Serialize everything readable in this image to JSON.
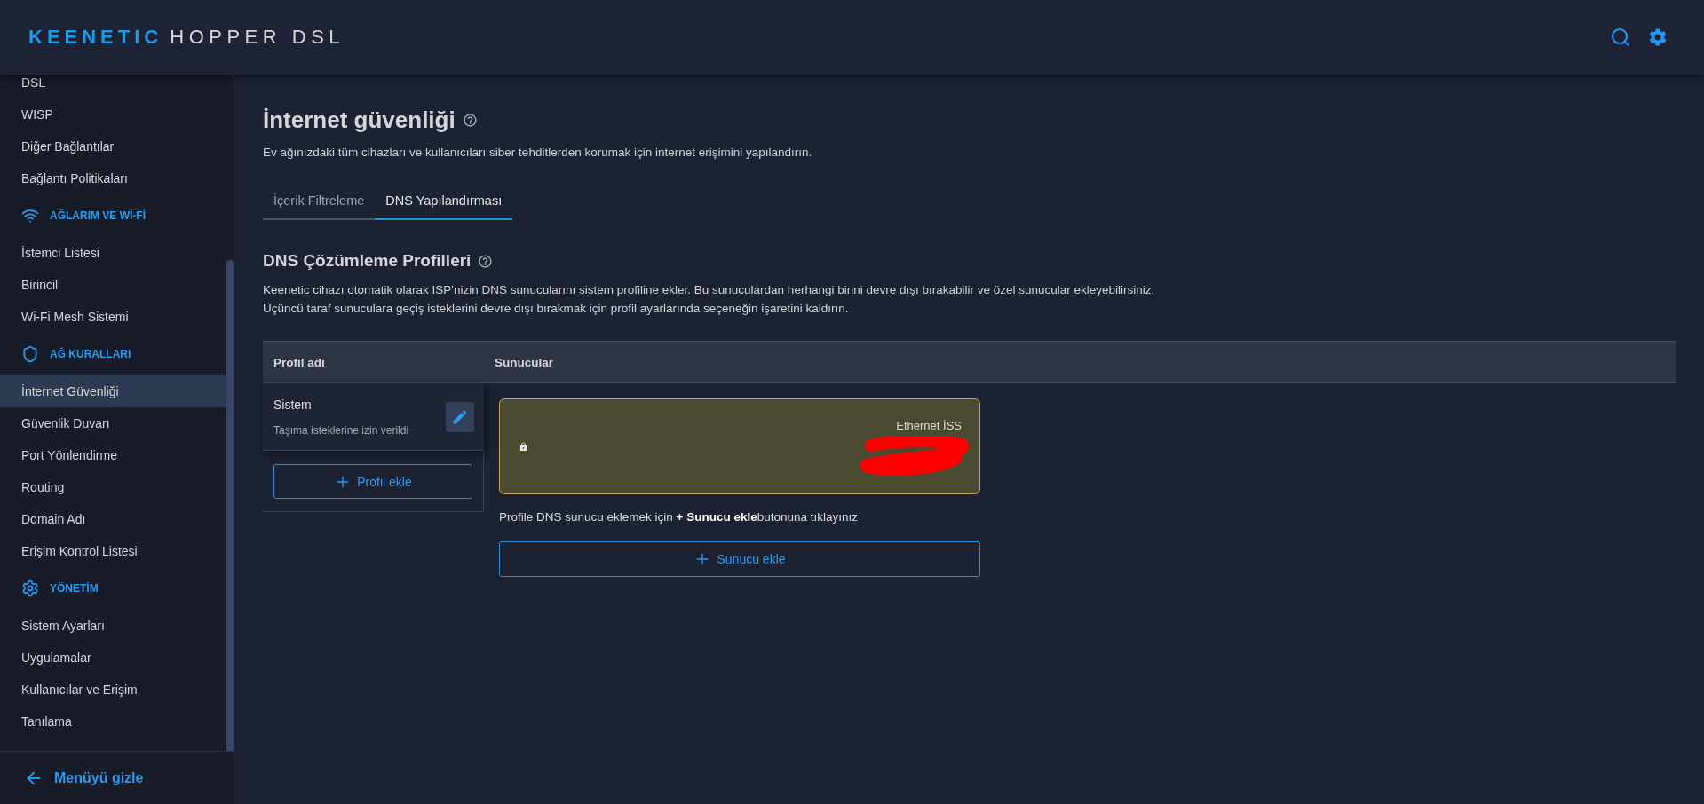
{
  "header": {
    "brand": "KEENETIC",
    "model": "HOPPER DSL"
  },
  "sidebar": {
    "items": [
      {
        "kind": "link",
        "label": "DSL",
        "selected": false
      },
      {
        "kind": "link",
        "label": "WISP",
        "selected": false
      },
      {
        "kind": "link",
        "label": "Diğer Bağlantılar",
        "selected": false
      },
      {
        "kind": "link",
        "label": "Bağlantı Politikaları",
        "selected": false
      },
      {
        "kind": "section",
        "label": "AĞLARIM VE Wİ-Fİ"
      },
      {
        "kind": "link",
        "label": "İstemci Listesi",
        "selected": false
      },
      {
        "kind": "link",
        "label": "Birincil",
        "selected": false
      },
      {
        "kind": "link",
        "label": "Wi-Fi Mesh Sistemi",
        "selected": false
      },
      {
        "kind": "section",
        "label": "AĞ KURALLARI"
      },
      {
        "kind": "link",
        "label": "İnternet Güvenliği",
        "selected": true
      },
      {
        "kind": "link",
        "label": "Güvenlik Duvarı",
        "selected": false
      },
      {
        "kind": "link",
        "label": "Port Yönlendirme",
        "selected": false
      },
      {
        "kind": "link",
        "label": "Routing",
        "selected": false
      },
      {
        "kind": "link",
        "label": "Domain Adı",
        "selected": false
      },
      {
        "kind": "link",
        "label": "Erişim Kontrol Listesi",
        "selected": false
      },
      {
        "kind": "section",
        "label": "YÖNETİM"
      },
      {
        "kind": "link",
        "label": "Sistem Ayarları",
        "selected": false
      },
      {
        "kind": "link",
        "label": "Uygulamalar",
        "selected": false
      },
      {
        "kind": "link",
        "label": "Kullanıcılar ve Erişim",
        "selected": false
      },
      {
        "kind": "link",
        "label": "Tanılama",
        "selected": false
      }
    ],
    "footer": {
      "label": "Menüyü gizle"
    }
  },
  "page": {
    "title": "İnternet güvenliği",
    "subtitle": "Ev ağınızdaki tüm cihazları ve kullanıcıları siber tehditlerden korumak için internet erişimini yapılandırın.",
    "tabs": [
      {
        "label": "İçerik Filtreleme",
        "selected": false
      },
      {
        "label": "DNS Yapılandırması",
        "selected": true
      }
    ]
  },
  "dns": {
    "title": "DNS Çözümleme Profilleri",
    "description": [
      "Keenetic cihazı otomatik olarak ISP'nizin DNS sunucularını sistem profiline ekler. Bu sunuculardan herhangi birini devre dışı bırakabilir ve özel sunucular ekleyebilirsiniz.",
      "Üçüncü taraf sunuculara geçiş isteklerini devre dışı bırakmak için profil ayarlarında seçeneğin işaretini kaldırın."
    ],
    "table": {
      "columns": [
        "Profil adı",
        "Sunucular"
      ],
      "profiles": [
        {
          "name": "Sistem",
          "note": "Taşıma isteklerine izin verildi",
          "selected": true
        }
      ],
      "add_profile": "Profil ekle",
      "servers": [
        {
          "label": "Ethernet İSS",
          "locked": true,
          "redacted": true
        }
      ],
      "hint": "Profile DNS sunucu eklemek için **+ Sunucu ekle**butonuna tıklayınız",
      "add_server": "Sunucu ekle"
    }
  }
}
